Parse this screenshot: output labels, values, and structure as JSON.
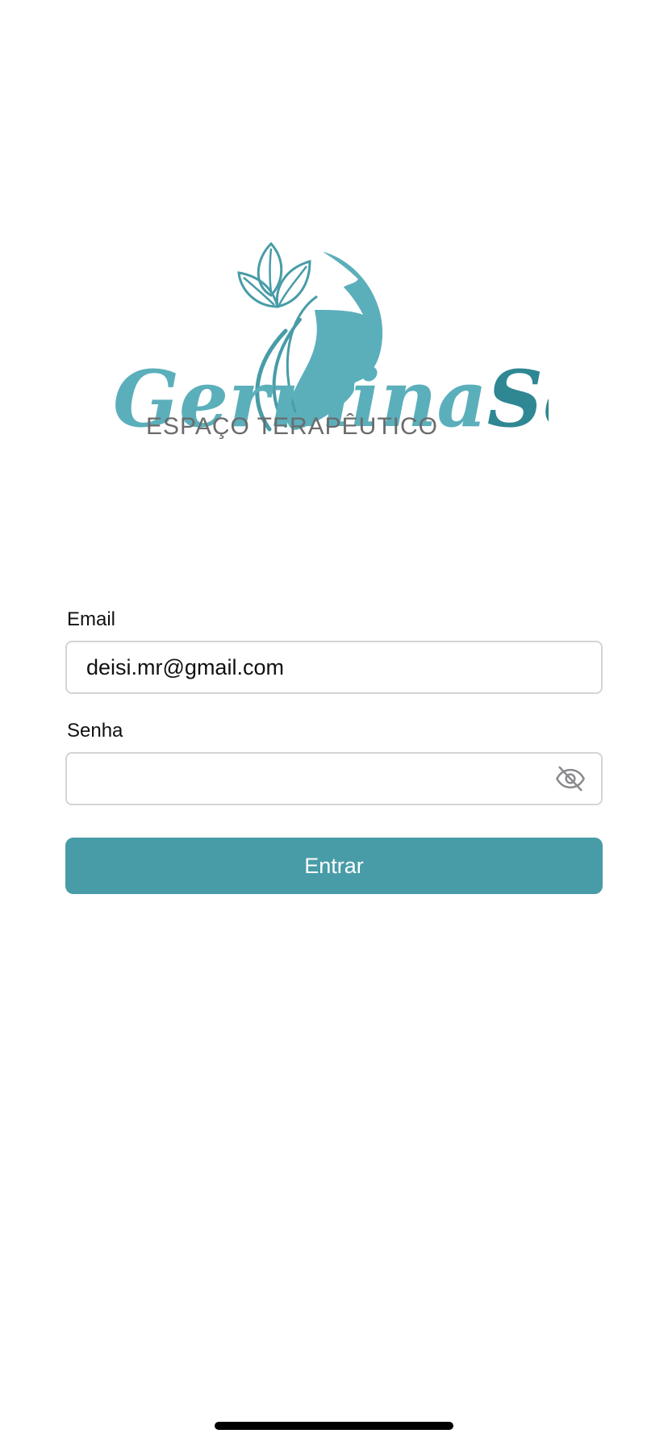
{
  "colors": {
    "brand_teal": "#489ca7",
    "brand_teal_dark": "#2f8793",
    "brand_teal_light": "#5bafbb",
    "subtitle_gray": "#6b6b6b",
    "input_border": "#d4d4d6",
    "button_bg": "#489ca7",
    "button_text": "#ffffff",
    "icon_gray": "#8a8a8e"
  },
  "logo": {
    "wordmark_part1": "Germina",
    "wordmark_part2": "Ser",
    "subtitle": "ESPAÇO TERAPÊUTICO",
    "icon": "woman-profile-with-leaves-icon"
  },
  "form": {
    "email": {
      "label": "Email",
      "value": "deisi.mr@gmail.com",
      "placeholder": ""
    },
    "password": {
      "label": "Senha",
      "value": "",
      "placeholder": "",
      "toggle_icon": "eye-slash-icon"
    },
    "submit_label": "Entrar"
  }
}
